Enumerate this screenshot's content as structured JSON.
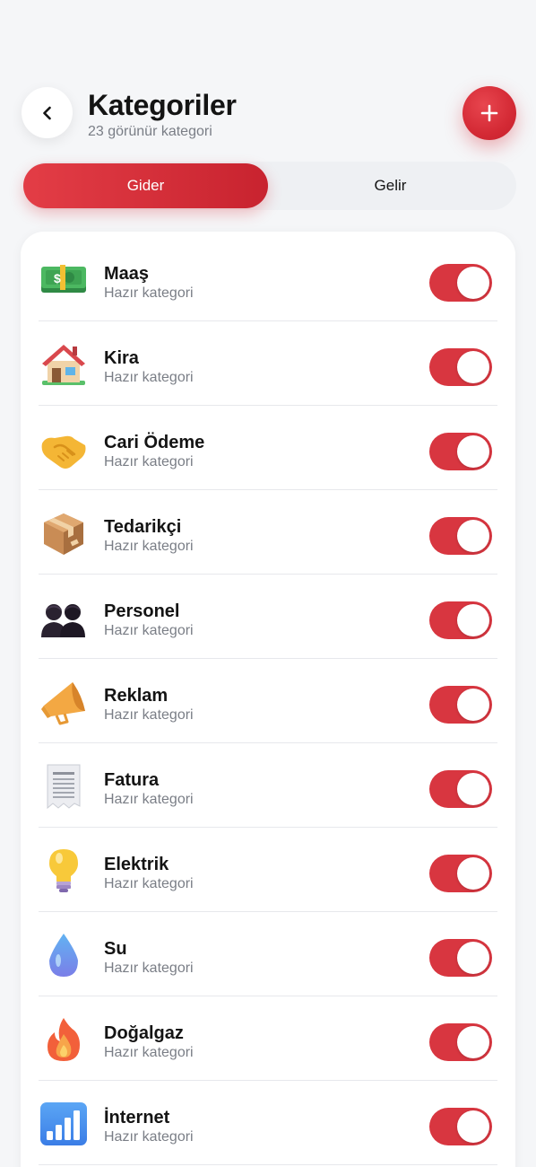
{
  "header": {
    "title": "Kategoriler",
    "subtitle": "23 görünür kategori"
  },
  "tabs": [
    {
      "label": "Gider",
      "active": true
    },
    {
      "label": "Gelir",
      "active": false
    }
  ],
  "categories": [
    {
      "name": "Maaş",
      "sub": "Hazır kategori",
      "icon": "money-icon",
      "enabled": true
    },
    {
      "name": "Kira",
      "sub": "Hazır kategori",
      "icon": "house-icon",
      "enabled": true
    },
    {
      "name": "Cari Ödeme",
      "sub": "Hazır kategori",
      "icon": "handshake-icon",
      "enabled": true
    },
    {
      "name": "Tedarikçi",
      "sub": "Hazır kategori",
      "icon": "package-icon",
      "enabled": true
    },
    {
      "name": "Personel",
      "sub": "Hazır kategori",
      "icon": "people-icon",
      "enabled": true
    },
    {
      "name": "Reklam",
      "sub": "Hazır kategori",
      "icon": "megaphone-icon",
      "enabled": true
    },
    {
      "name": "Fatura",
      "sub": "Hazır kategori",
      "icon": "receipt-icon",
      "enabled": true
    },
    {
      "name": "Elektrik",
      "sub": "Hazır kategori",
      "icon": "lightbulb-icon",
      "enabled": true
    },
    {
      "name": "Su",
      "sub": "Hazır kategori",
      "icon": "droplet-icon",
      "enabled": true
    },
    {
      "name": "Doğalgaz",
      "sub": "Hazır kategori",
      "icon": "fire-icon",
      "enabled": true
    },
    {
      "name": "İnternet",
      "sub": "Hazır kategori",
      "icon": "signal-bars-icon",
      "enabled": true
    }
  ],
  "colors": {
    "accent": "#d83640",
    "background": "#f5f6f8",
    "card": "#ffffff"
  }
}
